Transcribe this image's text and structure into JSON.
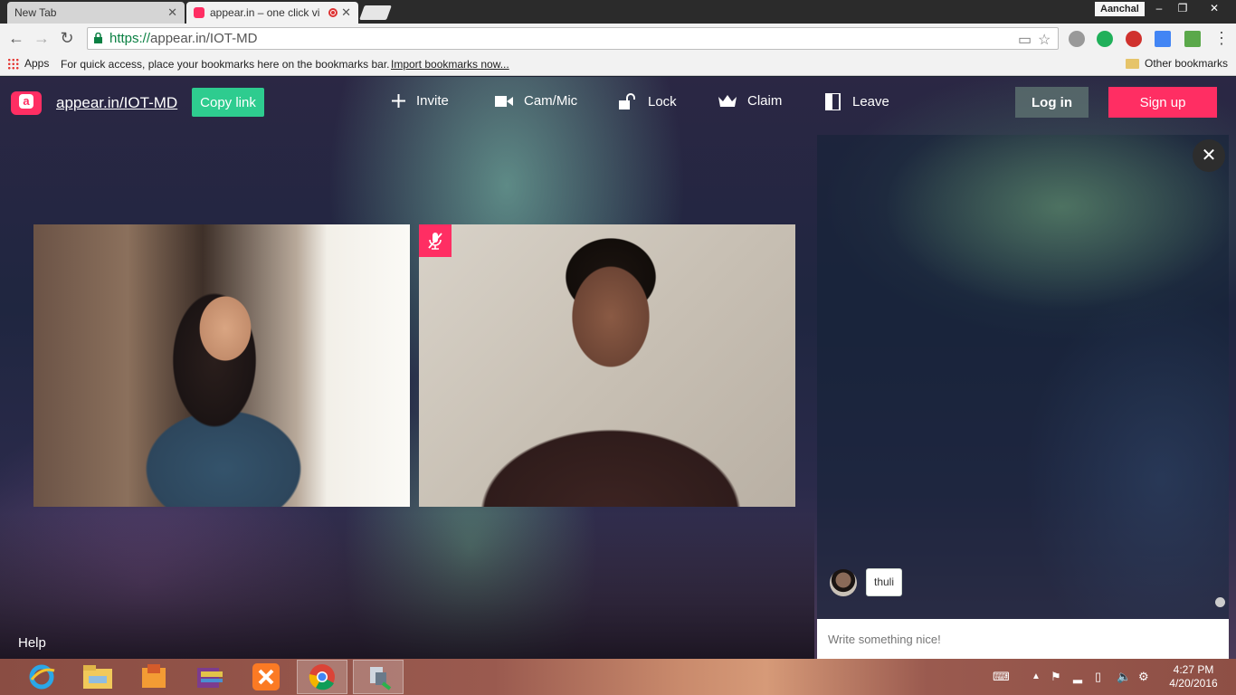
{
  "browser": {
    "tabs": [
      {
        "title": "New Tab",
        "close": "✕"
      },
      {
        "title": "appear.in – one click vi",
        "close": "✕"
      }
    ],
    "profile_name": "Aanchal",
    "window_buttons": {
      "minimize": "–",
      "restore": "❐",
      "close": "✕"
    },
    "url": {
      "scheme": "https://",
      "rest": "appear.in/IOT-MD"
    },
    "bookmarks": {
      "apps_label": "Apps",
      "hint": "For quick access, place your bookmarks here on the bookmarks bar.",
      "import_link": "Import bookmarks now...",
      "other": "Other bookmarks"
    }
  },
  "app": {
    "room_name": "appear.in/IOT-MD",
    "copy_link": "Copy link",
    "nav": {
      "invite": "Invite",
      "cam_mic": "Cam/Mic",
      "lock": "Lock",
      "claim": "Claim",
      "leave": "Leave"
    },
    "login": "Log in",
    "signup": "Sign up",
    "help": "Help",
    "chat": {
      "message": "thuli",
      "input_placeholder": "Write something nice!",
      "close": "✕"
    },
    "accent_color": "#ff2e63",
    "copy_color": "#2ecc8f"
  },
  "taskbar": {
    "apps": [
      "ie-icon",
      "file-explorer-icon",
      "media-icon",
      "winrar-icon",
      "xampp-icon",
      "chrome-icon",
      "network-tool-icon"
    ],
    "clock_time": "4:27 PM",
    "clock_date": "4/20/2016"
  }
}
